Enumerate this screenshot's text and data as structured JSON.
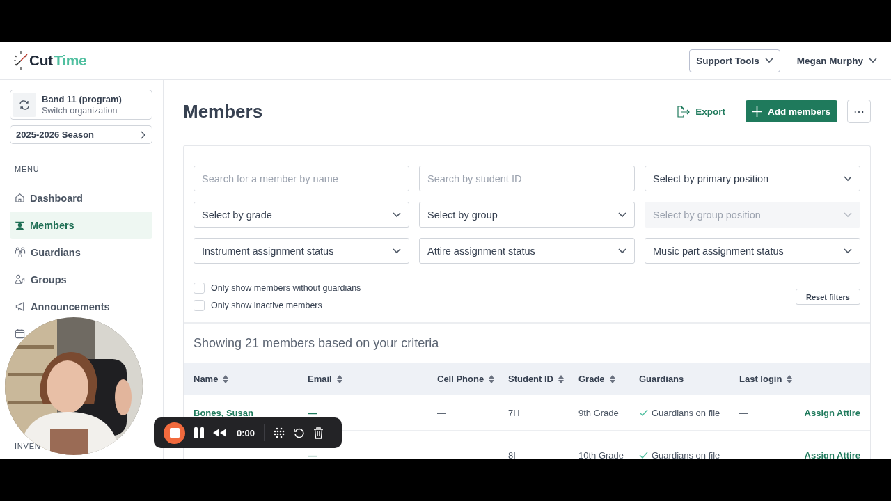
{
  "header": {
    "logo_dark": "Cut",
    "logo_accent": "Time",
    "support_tools": "Support Tools",
    "user": "Megan Murphy"
  },
  "sidebar": {
    "organization": {
      "name": "Band 11 (program)",
      "action": "Switch organization"
    },
    "season": "2025-2026 Season",
    "menu_heading": "MENU",
    "items": [
      {
        "label": "Dashboard",
        "selected": false
      },
      {
        "label": "Members",
        "selected": true
      },
      {
        "label": "Guardians",
        "selected": false
      },
      {
        "label": "Groups",
        "selected": false
      },
      {
        "label": "Announcements",
        "selected": false
      },
      {
        "selected": false
      }
    ],
    "section_heading": "INVEN"
  },
  "page": {
    "title": "Members",
    "export": "Export",
    "add": "Add members",
    "more": "⋯"
  },
  "filters": [
    {
      "kind": "search",
      "placeholder": "Search for a member by name"
    },
    {
      "kind": "search",
      "placeholder": "Search by student ID"
    },
    {
      "kind": "select",
      "value": "Select by primary position",
      "disabled": false
    },
    {
      "kind": "select",
      "value": "Select by grade",
      "disabled": false
    },
    {
      "kind": "select",
      "value": "Select by group",
      "disabled": false
    },
    {
      "kind": "select",
      "value": "Select by group position",
      "disabled": true
    },
    {
      "kind": "select",
      "value": "Instrument assignment status",
      "disabled": false
    },
    {
      "kind": "select",
      "value": "Attire assignment status",
      "disabled": false
    },
    {
      "kind": "select",
      "value": "Music part assignment status",
      "disabled": false
    }
  ],
  "checkboxes": [
    {
      "label": "Only show members without guardians",
      "checked": false
    },
    {
      "label": "Only show inactive members",
      "checked": false
    }
  ],
  "reset": "Reset filters",
  "summary": "Showing 21 members based on your criteria",
  "table": {
    "columns": [
      {
        "label": "Name",
        "sortable": true
      },
      {
        "label": "Email",
        "sortable": true
      },
      {
        "label": "Cell Phone",
        "sortable": true
      },
      {
        "label": "Student ID",
        "sortable": true
      },
      {
        "label": "Grade",
        "sortable": true
      },
      {
        "label": "Guardians",
        "sortable": false
      },
      {
        "label": "Last login",
        "sortable": true
      }
    ],
    "rows": [
      {
        "name": "Bones, Susan",
        "email": "—",
        "cell_phone": "—",
        "student_id": "7H",
        "grade": "9th Grade",
        "guardians": "Guardians on file",
        "guardians_on_file": true,
        "last_login": "—",
        "action": "Assign Attire"
      },
      {
        "email": "—",
        "cell_phone": "—",
        "student_id": "8I",
        "grade": "10th Grade",
        "guardians": "Guardians on file",
        "guardians_on_file": true,
        "last_login": "—",
        "action": "Assign Attire"
      }
    ]
  },
  "recorder": {
    "time": "0:00"
  }
}
